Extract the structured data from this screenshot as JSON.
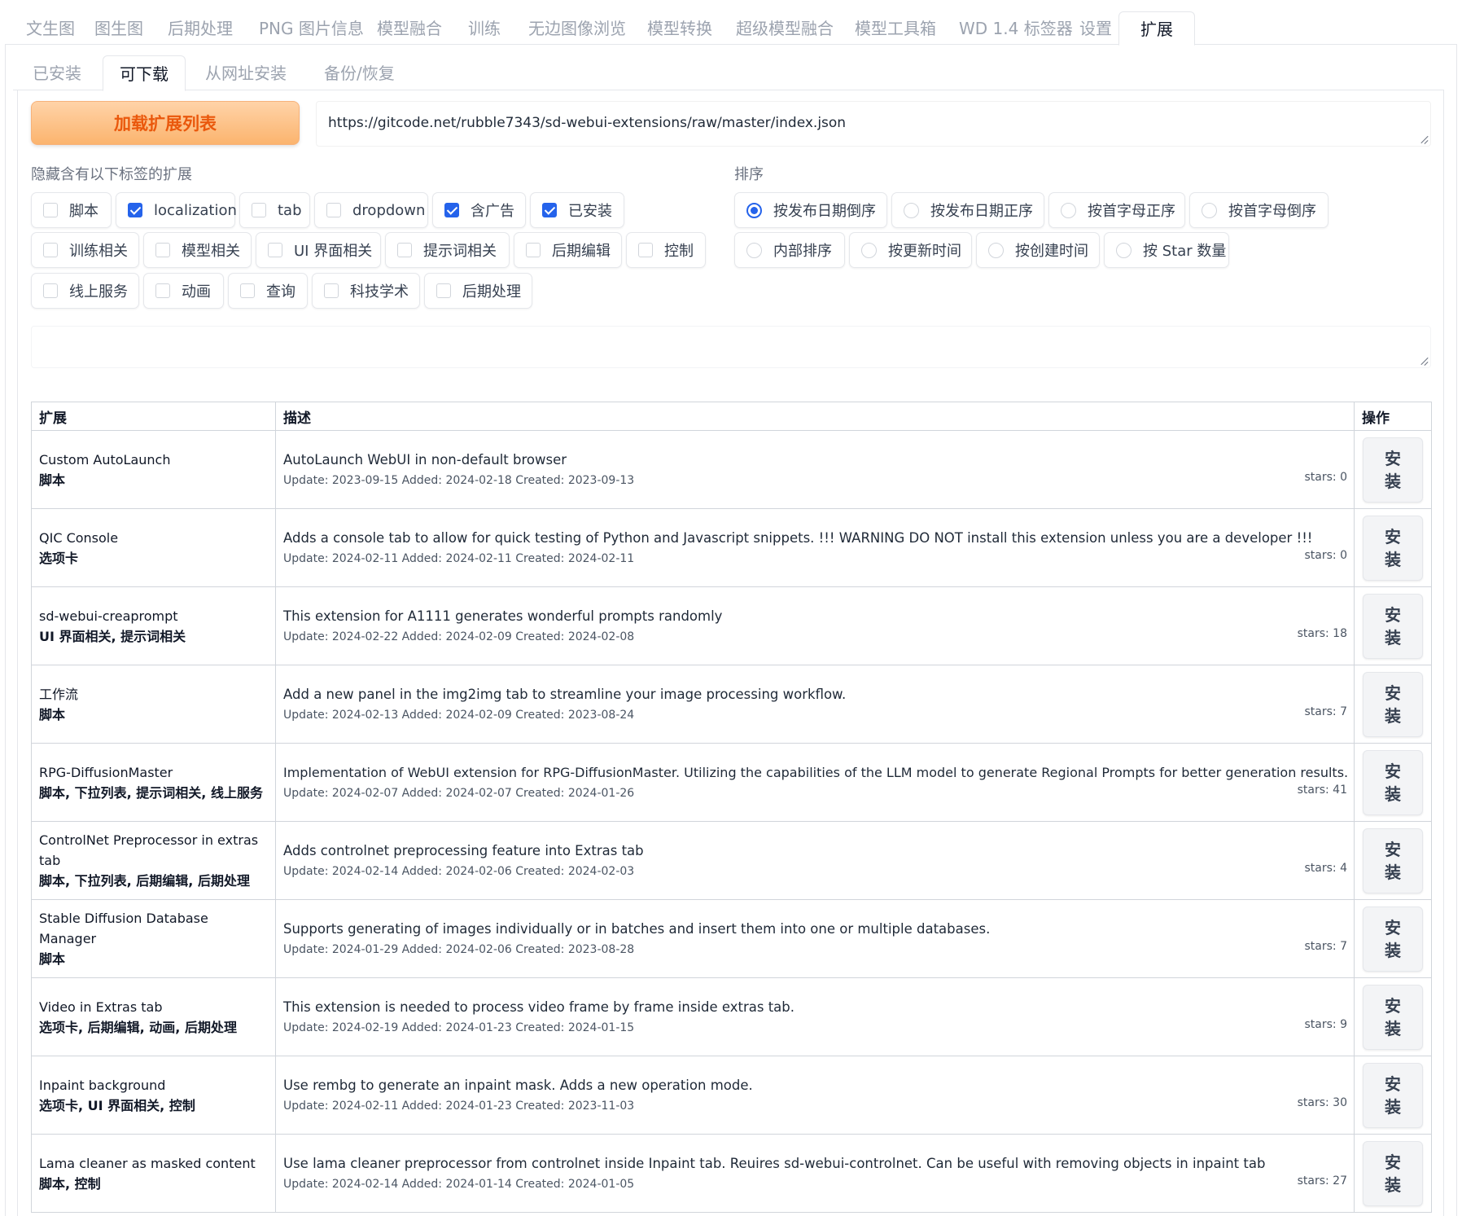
{
  "top_tabs": [
    {
      "label": "文生图",
      "active": false
    },
    {
      "label": "图生图",
      "active": false
    },
    {
      "label": "后期处理",
      "active": false
    },
    {
      "label": "PNG 图片信息",
      "active": false
    },
    {
      "label": "模型融合",
      "active": false
    },
    {
      "label": "训练",
      "active": false
    },
    {
      "label": "无边图像浏览",
      "active": false
    },
    {
      "label": "模型转换",
      "active": false
    },
    {
      "label": "超级模型融合",
      "active": false
    },
    {
      "label": "模型工具箱",
      "active": false
    },
    {
      "label": "WD 1.4 标签器",
      "active": false
    },
    {
      "label": "设置",
      "active": false
    },
    {
      "label": "扩展",
      "active": true
    }
  ],
  "sub_tabs": [
    {
      "label": "已安装",
      "active": false
    },
    {
      "label": "可下载",
      "active": true
    },
    {
      "label": "从网址安装",
      "active": false
    },
    {
      "label": "备份/恢复",
      "active": false
    }
  ],
  "load_button": "加载扩展列表",
  "url": "https://gitcode.net/rubble7343/sd-webui-extensions/raw/master/index.json",
  "hide_label": "隐藏含有以下标签的扩展",
  "hide_tags": [
    {
      "label": "脚本",
      "checked": false
    },
    {
      "label": "localization",
      "checked": true
    },
    {
      "label": "tab",
      "checked": false
    },
    {
      "label": "dropdown",
      "checked": false
    },
    {
      "label": "含广告",
      "checked": true
    },
    {
      "label": "已安装",
      "checked": true
    },
    {
      "label": "训练相关",
      "checked": false
    },
    {
      "label": "模型相关",
      "checked": false
    },
    {
      "label": "UI 界面相关",
      "checked": false
    },
    {
      "label": "提示词相关",
      "checked": false
    },
    {
      "label": "后期编辑",
      "checked": false
    },
    {
      "label": "控制",
      "checked": false
    },
    {
      "label": "线上服务",
      "checked": false
    },
    {
      "label": "动画",
      "checked": false
    },
    {
      "label": "查询",
      "checked": false
    },
    {
      "label": "科技学术",
      "checked": false
    },
    {
      "label": "后期处理",
      "checked": false
    }
  ],
  "sort_label": "排序",
  "sort_options": [
    {
      "label": "按发布日期倒序",
      "selected": true
    },
    {
      "label": "按发布日期正序",
      "selected": false
    },
    {
      "label": "按首字母正序",
      "selected": false
    },
    {
      "label": "按首字母倒序",
      "selected": false
    },
    {
      "label": "内部排序",
      "selected": false
    },
    {
      "label": "按更新时间",
      "selected": false
    },
    {
      "label": "按创建时间",
      "selected": false
    },
    {
      "label": "按 Star 数量",
      "selected": false
    }
  ],
  "search_value": "",
  "table": {
    "headers": [
      "扩展",
      "描述",
      "操作"
    ],
    "install_label": "安装",
    "rows": [
      {
        "name": "Custom AutoLaunch",
        "tags": "脚本",
        "desc": "AutoLaunch WebUI in non-default browser",
        "meta": "Update: 2023-09-15 Added: 2024-02-18 Created: 2023-09-13",
        "stars": "stars: 0"
      },
      {
        "name": "QIC Console",
        "tags": "选项卡",
        "desc": "Adds a console tab to allow for quick testing of Python and Javascript snippets. !!! WARNING DO NOT install this extension unless you are a developer !!!",
        "meta": "Update: 2024-02-11 Added: 2024-02-11 Created: 2024-02-11",
        "stars": "stars: 0"
      },
      {
        "name": "sd-webui-creaprompt",
        "tags": "UI 界面相关, 提示词相关",
        "desc": "This extension for A1111 generates wonderful prompts randomly",
        "meta": "Update: 2024-02-22 Added: 2024-02-09 Created: 2024-02-08",
        "stars": "stars: 18"
      },
      {
        "name": "工作流",
        "tags": "脚本",
        "desc": "Add a new panel in the img2img tab to streamline your image processing workflow.",
        "meta": "Update: 2024-02-13 Added: 2024-02-09 Created: 2023-08-24",
        "stars": "stars: 7"
      },
      {
        "name": "RPG-DiffusionMaster",
        "tags": "脚本, 下拉列表, 提示词相关, 线上服务",
        "desc": "Implementation of WebUI extension for RPG-DiffusionMaster. Utilizing the capabilities of the LLM model to generate Regional Prompts for better generation results.",
        "meta": "Update: 2024-02-07 Added: 2024-02-07 Created: 2024-01-26",
        "stars": "stars: 41"
      },
      {
        "name": "ControlNet Preprocessor in extras tab",
        "tags": "脚本, 下拉列表, 后期编辑, 后期处理",
        "desc": "Adds controlnet preprocessing feature into Extras tab",
        "meta": "Update: 2024-02-14 Added: 2024-02-06 Created: 2024-02-03",
        "stars": "stars: 4"
      },
      {
        "name": "Stable Diffusion Database Manager",
        "tags": "脚本",
        "desc": "Supports generating of images individually or in batches and insert them into one or multiple databases.",
        "meta": "Update: 2024-01-29 Added: 2024-02-06 Created: 2023-08-28",
        "stars": "stars: 7"
      },
      {
        "name": "Video in Extras tab",
        "tags": "选项卡, 后期编辑, 动画, 后期处理",
        "desc": "This extension is needed to process video frame by frame inside extras tab.",
        "meta": "Update: 2024-02-19 Added: 2024-01-23 Created: 2024-01-15",
        "stars": "stars: 9"
      },
      {
        "name": "Inpaint background",
        "tags": "选项卡, UI 界面相关, 控制",
        "desc": "Use rembg to generate an inpaint mask. Adds a new operation mode.",
        "meta": "Update: 2024-02-11 Added: 2024-01-23 Created: 2023-11-03",
        "stars": "stars: 30"
      },
      {
        "name": "Lama cleaner as masked content",
        "tags": "脚本, 控制",
        "desc": "Use lama cleaner preprocessor from controlnet inside Inpaint tab. Reuires sd-webui-controlnet. Can be useful with removing objects in inpaint tab",
        "meta": "Update: 2024-02-14 Added: 2024-01-14 Created: 2024-01-05",
        "stars": "stars: 27"
      }
    ]
  }
}
